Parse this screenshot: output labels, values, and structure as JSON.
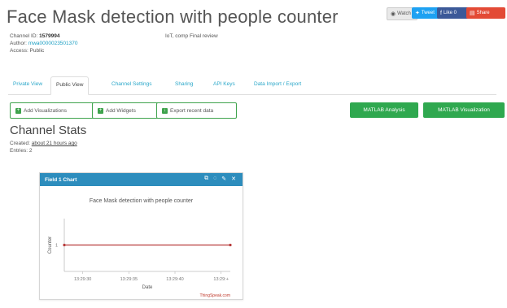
{
  "page": {
    "title": "Face Mask detection with people counter"
  },
  "share_buttons": [
    {
      "label": "Watch",
      "icon": "eye-icon",
      "color": "#e9e9e9"
    },
    {
      "label": "Tweet",
      "icon": "twitter-icon",
      "color": "#1da1f2"
    },
    {
      "label": "Like 0",
      "icon": "facebook-icon",
      "color": "#3b5998"
    },
    {
      "label": "Share",
      "icon": "share-icon",
      "color": "#e34a35"
    }
  ],
  "channel": {
    "id_label": "Channel ID:",
    "id_value": "1579994",
    "author_label": "Author:",
    "author_value": "mwa0000023501370",
    "access": "Access: Public",
    "tags": "IoT, comp Final review"
  },
  "tabs": [
    {
      "label": "Private View",
      "active": false
    },
    {
      "label": "Public View",
      "active": true
    },
    {
      "label": "Channel Settings",
      "active": false
    },
    {
      "label": "Sharing",
      "active": false
    },
    {
      "label": "API Keys",
      "active": false
    },
    {
      "label": "Data Import / Export",
      "active": false
    }
  ],
  "actions": {
    "add_visualizations": "Add Visualizations",
    "add_widgets": "Add Widgets",
    "export_data": "Export recent data",
    "matlab_analysis": "MATLAB Analysis",
    "matlab_visualization": "MATLAB Visualization"
  },
  "stats": {
    "heading": "Channel Stats",
    "created_label": "Created:",
    "created_value": "about 21 hours ago",
    "entries": "Entries: 2"
  },
  "widget": {
    "header": "Field 1 Chart",
    "header_icons": [
      "external-link-icon",
      "comment-icon",
      "pencil-icon",
      "close-icon"
    ],
    "credit": "ThingSpeak.com"
  },
  "chart_data": {
    "type": "line",
    "title": "Face Mask detection with people counter",
    "xlabel": "Date",
    "ylabel": "Counter",
    "x_ticks": [
      "13:29:30",
      "13:29:35",
      "13:29:40",
      "13:29:+"
    ],
    "y_ticks": [
      "1"
    ],
    "series": [
      {
        "color": "#b73a3a",
        "x": [
          "13:29:28",
          "13:29:46"
        ],
        "values": [
          1,
          1
        ]
      }
    ]
  }
}
